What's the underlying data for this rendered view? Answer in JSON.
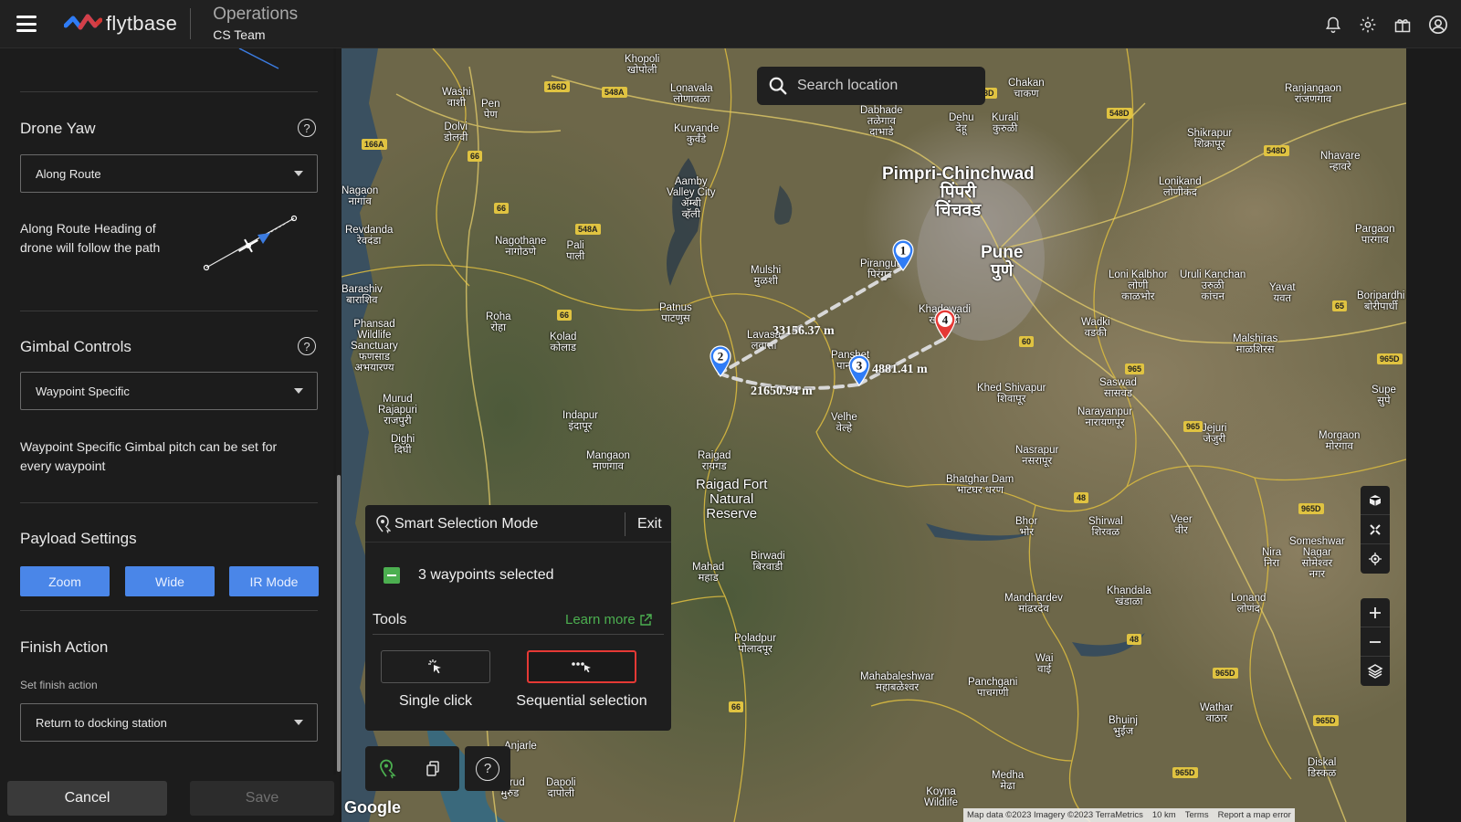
{
  "header": {
    "logo_text": "flytbase",
    "org_title": "Operations",
    "org_sub": "CS Team"
  },
  "panel": {
    "drone_yaw": {
      "title": "Drone Yaw",
      "value": "Along Route",
      "desc_line1": "Along Route Heading of",
      "desc_line2": "drone will follow the path"
    },
    "gimbal": {
      "title": "Gimbal Controls",
      "value": "Waypoint Specific",
      "desc_line1": "Waypoint Specific Gimbal pitch can be set for",
      "desc_line2": "every waypoint"
    },
    "payload": {
      "title": "Payload Settings",
      "buttons": [
        "Zoom",
        "Wide",
        "IR Mode"
      ]
    },
    "finish": {
      "title": "Finish Action",
      "label": "Set finish action",
      "value": "Return to docking station"
    },
    "help_glyph": "?",
    "cancel": "Cancel",
    "save": "Save"
  },
  "map": {
    "search_placeholder": "Search location",
    "distances": [
      "33156.37 m",
      "21650.94 m",
      "4881.41 m"
    ],
    "waypoints": [
      "1",
      "2",
      "3",
      "4"
    ],
    "places": {
      "pimpri_en": "Pimpri-Chinchwad",
      "pimpri_mr1": "पिंपरी",
      "pimpri_mr2": "चिंचवड",
      "pune_en": "Pune",
      "pune_mr": "पुणे",
      "khopoli": "Khopoli\nखोपोली",
      "lonavala": "Lonavala\nलोणावळा",
      "chakan": "Chakan\nचाकण",
      "ranjangaon": "Ranjangaon\nरांजणगाव",
      "washi": "Washi\nवाशी",
      "pen": "Pen\nपेण",
      "dolvi": "Dolvi\nडोलवी",
      "kurvande": "Kurvande\nकुर्वंडे",
      "talegaon": "Talegaon\nDabhade\nतळेगाव\nदाभाडे",
      "dehu": "Dehu\nदेहू",
      "kurali": "Kurali\nकुरुळी",
      "shikrapur": "Shikrapur\nशिक्रापूर",
      "nagaon": "Nagaon\nनागांव",
      "aamby": "Aamby\nValley City\nॲम्बी\nव्हॅली",
      "lonikand": "Lonikand\nलोणीकंद",
      "nhavare": "Nhavare\nन्हावरे",
      "revdanda": "Revdanda\nरेवदंडा",
      "nagothane": "Nagothane\nनागोठणे",
      "pali": "Pali\nपाली",
      "mulshi": "Mulshi\nमुळशी",
      "pirangut": "Pirangut\nपिरंगुट",
      "pargaon": "Pargaon\nपारगाव",
      "barashiv": "Barashiv\nबाराशिव",
      "patnus": "Patnus\nपाटणुस",
      "roha": "Roha\nरोहा",
      "loni": "Loni Kalbhor\nलोणी\nकाळभोर",
      "uruli": "Uruli Kanchan\nउरुळी\nकांचन",
      "yavat": "Yavat\nयवत",
      "boripardhi": "Boripardhi\nबोरीपार्धी",
      "phansad": "Phansad\nWildlife\nSanctuary\nफणसाड\nअभयारण्य",
      "kolad": "Kolad\nकोलाड",
      "lavasa": "Lavasa\nलवासा",
      "khadewadi": "Khadewadi\nखडेवाडी",
      "wadki": "Wadki\nवडकी",
      "malshiras": "Malshiras\nमाळशिरस",
      "panshet": "Panshet\nपानशेत",
      "saswad": "Saswad\nसासवड",
      "khed_shivapur": "Khed Shivapur\nशिवापूर",
      "supe": "Supe\nसुपे",
      "murud": "Murud\nRajapuri\nराजपुरी",
      "indapur": "Indapur\nइंदापूर",
      "velhe": "Velhe\nवेल्हे",
      "narayanpur": "Narayanpur\nनारायणपूर",
      "jejuri": "Jejuri\nजेजुरी",
      "morgaon": "Morgaon\nमोरगाव",
      "dighi": "Dighi\nदिघी",
      "mangaon": "Mangaon\nमाणगाव",
      "raigad": "Raigad\nरायगड",
      "nasrapur": "Nasrapur\nनसरापूर",
      "raigad_fort": "Raigad Fort\nNatural\nReserve",
      "bhatghar": "Bhatghar Dam\nभाटघर धरण",
      "bhor": "Bhor\nभोर",
      "shirwal": "Shirwal\nशिरवळ",
      "veer": "Veer\nवीर",
      "birwadi": "Birwadi\nबिरवाडी",
      "mahad": "Mahad\nमहाड",
      "nira": "Nira\nनिरा",
      "someshwar": "Someshwar\nNagar\nसोमेश्वर\nनगर",
      "khandala": "Khandala\nखंडाळा",
      "mandhardev": "Mandhardev\nमांढरदेव",
      "lonand": "Lonand\nलोणंद",
      "poladpur": "Poladpur\nपोलादपूर",
      "wai": "Wai\nवाई",
      "mahabaleshwar": "Mahabaleshwar\nमहाबळेश्वर",
      "panchgani": "Panchgani\nपाचगणी",
      "wathar": "Wathar\nवाठार",
      "bhuinj": "Bhuinj\nभुईंज",
      "anjarle": "Anjarle",
      "dapoli": "Dapoli\nदापोली",
      "murud2": "Murud\nमुरुड",
      "medha": "Medha\nमेढा",
      "koyna": "Koyna\nWildlife",
      "diskal": "Diskal\nडिस्कळ"
    },
    "roads": [
      "166D",
      "548A",
      "548D",
      "548D",
      "548D",
      "166A",
      "66",
      "66",
      "548A",
      "66",
      "65",
      "60",
      "965",
      "965D",
      "965",
      "48",
      "965D",
      "48",
      "965D",
      "66",
      "965D",
      "965D"
    ],
    "google": "Google",
    "attribution": [
      "Map data ©2023 Imagery ©2023 TerraMetrics",
      "10 km",
      "Terms",
      "Report a map error"
    ]
  },
  "smart_selection": {
    "title": "Smart Selection Mode",
    "exit": "Exit",
    "selected": "3 waypoints selected",
    "tools_label": "Tools",
    "learn_more": "Learn more",
    "single_click": "Single click",
    "sequential": "Sequential selection",
    "help_glyph": "?"
  }
}
